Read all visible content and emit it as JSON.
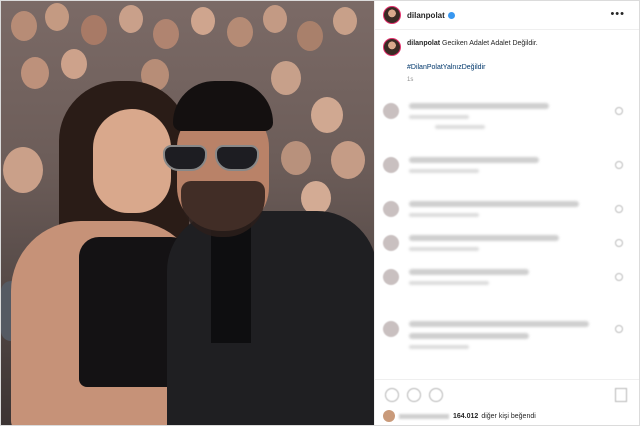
{
  "post": {
    "username": "dilanpolat",
    "more_icon": "more-horizontal-icon",
    "caption_username": "dilanpolat",
    "caption_text": "Geciken Adalet Adalet Değildir.",
    "hashtag": "#DilanPolatYalnızDeğildir",
    "time_label": "1s",
    "likes_count": "164.012",
    "likes_suffix": "diğer kişi beğendi"
  },
  "colors": {
    "verified": "#3897f0",
    "hashtag": "#00376b",
    "text": "#262626",
    "muted": "#8e8e8e"
  },
  "icons": [
    "heart-icon",
    "comment-icon",
    "share-icon",
    "bookmark-icon"
  ]
}
